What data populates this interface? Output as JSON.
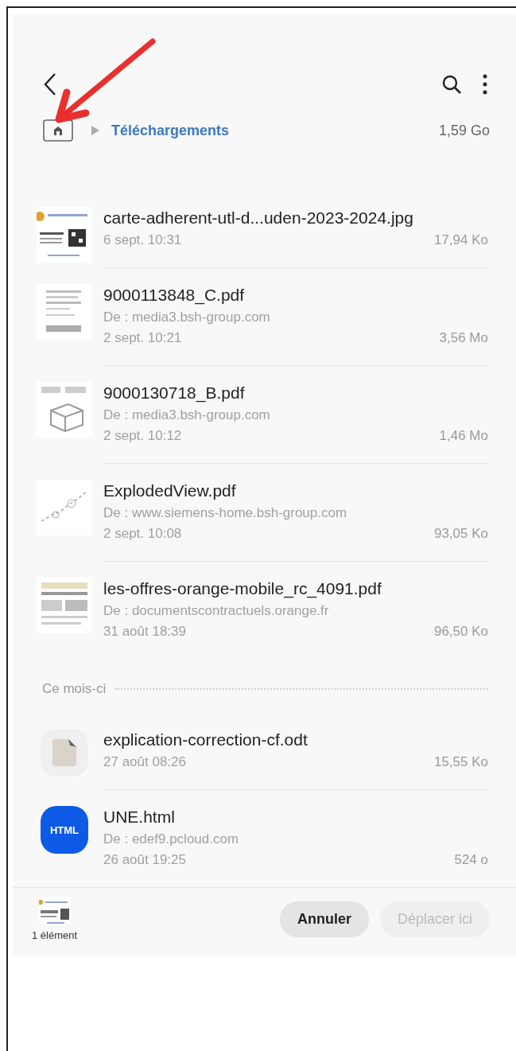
{
  "annotation_arrow": true,
  "breadcrumb": {
    "folder": "Téléchargements",
    "size": "1,59 Go"
  },
  "items": [
    {
      "kind": "card",
      "name": "carte-adherent-utl-d...uden-2023-2024.jpg",
      "date": "6 sept. 10:31",
      "size": "17,94 Ko"
    },
    {
      "kind": "document",
      "name": "9000113848_C.pdf",
      "source": "De : media3.bsh-group.com",
      "date": "2 sept. 10:21",
      "size": "3,56 Mo"
    },
    {
      "kind": "drawing",
      "name": "9000130718_B.pdf",
      "source": "De : media3.bsh-group.com",
      "date": "2 sept. 10:12",
      "size": "1,46 Mo"
    },
    {
      "kind": "sketch",
      "name": "ExplodedView.pdf",
      "source": "De : www.siemens-home.bsh-group.com",
      "date": "2 sept. 10:08",
      "size": "93,05 Ko"
    },
    {
      "kind": "brochure",
      "name": "les-offres-orange-mobile_rc_4091.pdf",
      "source": "De : documentscontractuels.orange.fr",
      "date": "31 août 18:39",
      "size": "96,50 Ko"
    },
    {
      "kind": "section",
      "title": "Ce mois-ci"
    },
    {
      "kind": "odt",
      "name": "explication-correction-cf.odt",
      "date": "27 août 08:26",
      "size": "15,55 Ko"
    },
    {
      "kind": "html",
      "icon_text": "HTML",
      "name": "UNE.html",
      "source": "De : edef9.pcloud.com",
      "date": "26 août 19:25",
      "size": "524 o"
    }
  ],
  "selection": {
    "count_label": "1 élément"
  },
  "buttons": [
    {
      "label": "Annuler",
      "disabled": false
    },
    {
      "label": "Déplacer ici",
      "disabled": true
    }
  ]
}
